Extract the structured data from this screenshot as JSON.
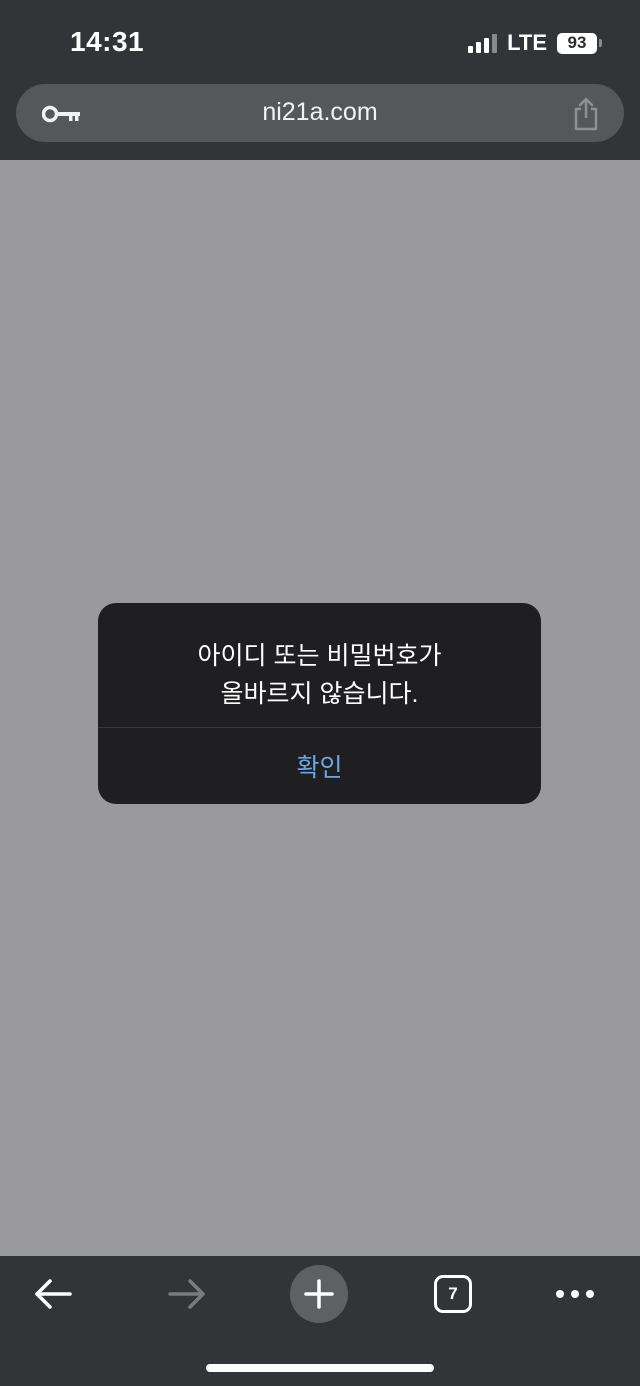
{
  "status_bar": {
    "time": "14:31",
    "network": "LTE",
    "battery": "93",
    "icons": [
      "signal-icon",
      "battery-icon"
    ]
  },
  "address_bar": {
    "url": "ni21a.com",
    "icons": [
      "key-icon",
      "share-icon"
    ]
  },
  "alert": {
    "message_line1": "아이디 또는 비밀번호가",
    "message_line2": "올바르지 않습니다.",
    "confirm_label": "확인",
    "confirm_color": "#6aa7e6"
  },
  "toolbar": {
    "tabs_count": "7",
    "icons": [
      "back-arrow-icon",
      "forward-arrow-icon",
      "plus-icon",
      "tabs-icon",
      "more-icon"
    ]
  },
  "colors": {
    "chrome_background": "#333438",
    "page_background": "#9a999c",
    "alert_background": "#1f1f21"
  }
}
